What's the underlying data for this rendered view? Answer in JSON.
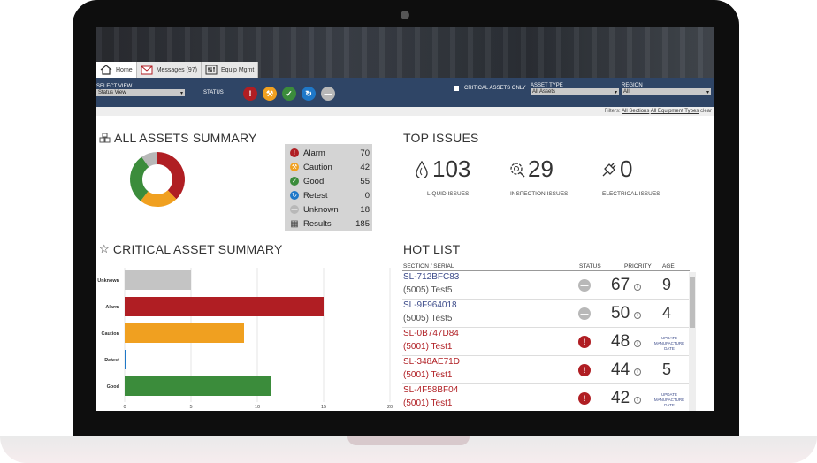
{
  "tabs": [
    {
      "label": "Home",
      "icon": "home-icon"
    },
    {
      "label": "Messages (97)",
      "icon": "mail-icon"
    },
    {
      "label": "Equip Mgmt",
      "icon": "equipment-icon"
    }
  ],
  "navbar": {
    "select_view_label": "SELECT VIEW",
    "select_view_value": "Status View",
    "status_label": "STATUS",
    "critical_only_label": "CRITICAL ASSETS ONLY",
    "asset_type_label": "ASSET TYPE",
    "asset_type_value": "All Assets",
    "region_label": "REGION",
    "region_value": "All"
  },
  "status_buttons": [
    {
      "name": "alarm",
      "symbol": "!",
      "color": "#b01e23"
    },
    {
      "name": "caution",
      "symbol": "⚒",
      "color": "#f0a020"
    },
    {
      "name": "good",
      "symbol": "✓",
      "color": "#3b8c3b"
    },
    {
      "name": "retest",
      "symbol": "↻",
      "color": "#1f78c8"
    },
    {
      "name": "unknown",
      "symbol": "—",
      "color": "#b8b8b8"
    }
  ],
  "filters": {
    "label": "Filters:",
    "sections": "All Sections",
    "equipment": "All Equipment Types",
    "clear": "clear"
  },
  "all_assets": {
    "title": "ALL ASSETS SUMMARY",
    "legend": [
      {
        "label": "Alarm",
        "value": "70",
        "color": "#b01e23",
        "symbol": "!"
      },
      {
        "label": "Caution",
        "value": "42",
        "color": "#f0a020",
        "symbol": "⚒"
      },
      {
        "label": "Good",
        "value": "55",
        "color": "#3b8c3b",
        "symbol": "✓"
      },
      {
        "label": "Retest",
        "value": "0",
        "color": "#1f78c8",
        "symbol": "↻"
      },
      {
        "label": "Unknown",
        "value": "18",
        "color": "#b8b8b8",
        "symbol": "—"
      },
      {
        "label": "Results",
        "value": "185",
        "color": "",
        "symbol": ""
      }
    ]
  },
  "top_issues": {
    "title": "TOP ISSUES",
    "items": [
      {
        "value": "103",
        "label": "LIQUID ISSUES",
        "icon": "droplet-icon"
      },
      {
        "value": "29",
        "label": "INSPECTION ISSUES",
        "icon": "inspection-gear-icon"
      },
      {
        "value": "0",
        "label": "ELECTRICAL ISSUES",
        "icon": "plug-icon"
      }
    ]
  },
  "critical": {
    "title": "CRITICAL ASSET SUMMARY"
  },
  "hot_list": {
    "title": "HOT LIST",
    "headers": {
      "serial": "SECTION / SERIAL",
      "status": "STATUS",
      "priority": "PRIORITY",
      "age": "AGE"
    },
    "rows": [
      {
        "serial": "SL-712BFC83",
        "sub": "(5005) Test5",
        "status": "unknown",
        "priority": "67",
        "age": "9",
        "age_note": ""
      },
      {
        "serial": "SL-9F964018",
        "sub": "(5005) Test5",
        "status": "unknown",
        "priority": "50",
        "age": "4",
        "age_note": ""
      },
      {
        "serial": "SL-0B747D84",
        "sub": "(5001) Test1",
        "status": "alarm",
        "priority": "48",
        "age": "",
        "age_note": "UPDATE MANUFACTURE DATE"
      },
      {
        "serial": "SL-348AE71D",
        "sub": "(5001) Test1",
        "status": "alarm",
        "priority": "44",
        "age": "5",
        "age_note": ""
      },
      {
        "serial": "SL-4F58BF04",
        "sub": "(5001) Test1",
        "status": "alarm",
        "priority": "42",
        "age": "",
        "age_note": "UPDATE MANUFACTURE DATE"
      }
    ]
  },
  "chart_data": [
    {
      "type": "pie",
      "categories": [
        "Alarm",
        "Caution",
        "Good",
        "Retest",
        "Unknown"
      ],
      "values": [
        70,
        42,
        55,
        0,
        18
      ],
      "colors": [
        "#b01e23",
        "#f0a020",
        "#3b8c3b",
        "#1f78c8",
        "#b8b8b8"
      ],
      "title": "ALL ASSETS SUMMARY"
    },
    {
      "type": "bar",
      "orientation": "horizontal",
      "title": "CRITICAL ASSET SUMMARY",
      "categories": [
        "Unknown",
        "Alarm",
        "Caution",
        "Retest",
        "Good"
      ],
      "values": [
        5,
        15,
        9,
        0.1,
        11
      ],
      "colors": [
        "#c4c4c4",
        "#b01e23",
        "#f0a020",
        "#1f78c8",
        "#3b8c3b"
      ],
      "xlim": [
        0,
        20
      ],
      "xticks": [
        "0",
        "5",
        "10",
        "15",
        "20"
      ],
      "grid": true
    }
  ]
}
